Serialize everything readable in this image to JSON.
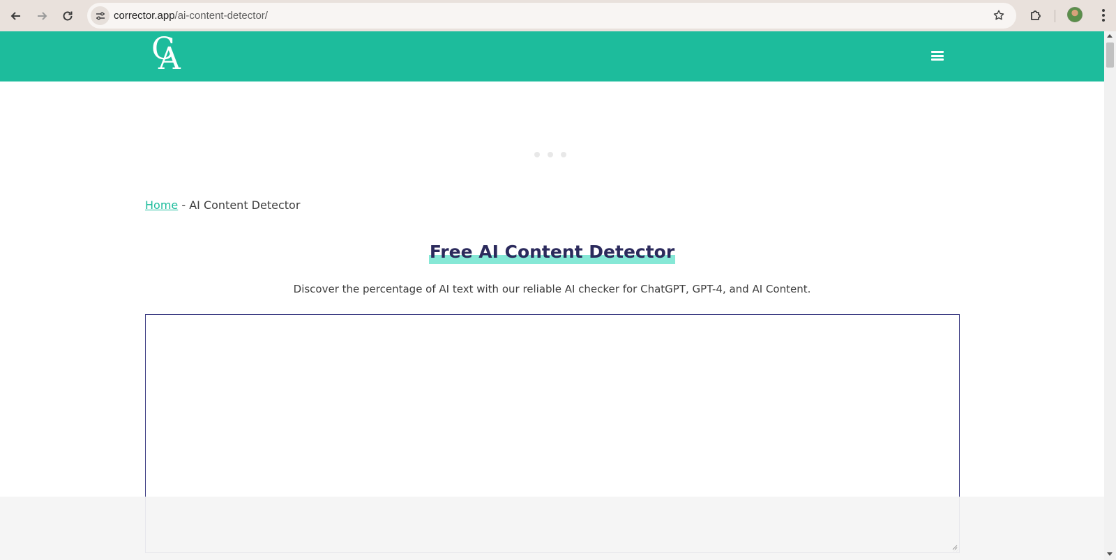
{
  "browser": {
    "url_host": "corrector.app",
    "url_path": "/ai-content-detector/"
  },
  "header": {
    "logo_letters": "CA"
  },
  "breadcrumb": {
    "home": "Home",
    "separator": " - ",
    "current": "AI Content Detector"
  },
  "main": {
    "title": "Free AI Content Detector",
    "subtitle": "Discover the percentage of AI text with our reliable AI checker for ChatGPT, GPT-4, and AI Content.",
    "textarea_value": ""
  },
  "colors": {
    "brand": "#1dbc9c",
    "title_highlight": "#86e8d6",
    "title_text": "#2b2a5c",
    "textarea_border": "#3b3b82"
  }
}
